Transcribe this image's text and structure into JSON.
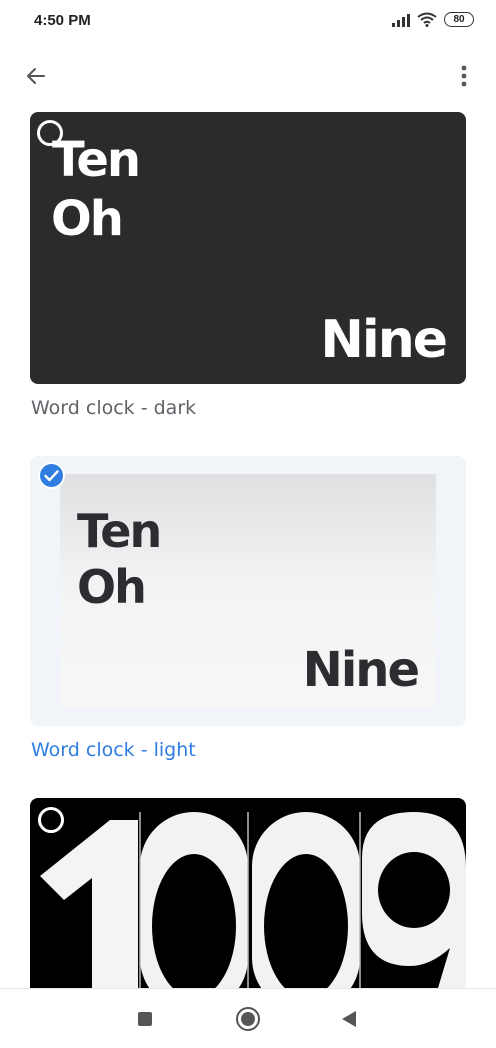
{
  "status_bar": {
    "time": "4:50 PM",
    "battery": "80"
  },
  "app_bar": {
    "back_icon": "arrow-left-icon",
    "more_icon": "more-vert-icon"
  },
  "cards": [
    {
      "caption": "Word clock - dark",
      "selected": false,
      "line1": "Ten",
      "line2": "Oh",
      "line3": "Nine"
    },
    {
      "caption": "Word clock - light",
      "selected": true,
      "line1": "Ten",
      "line2": "Oh",
      "line3": "Nine"
    },
    {
      "caption": "",
      "selected": false,
      "digits": "1009"
    }
  ],
  "colors": {
    "accent": "#2f7de1",
    "caption_default": "#5f6368",
    "dark_card": "#2a2b2a"
  },
  "nav_bar": {
    "recents_icon": "square-icon",
    "home_icon": "circle-icon",
    "back_icon": "triangle-back-icon"
  }
}
